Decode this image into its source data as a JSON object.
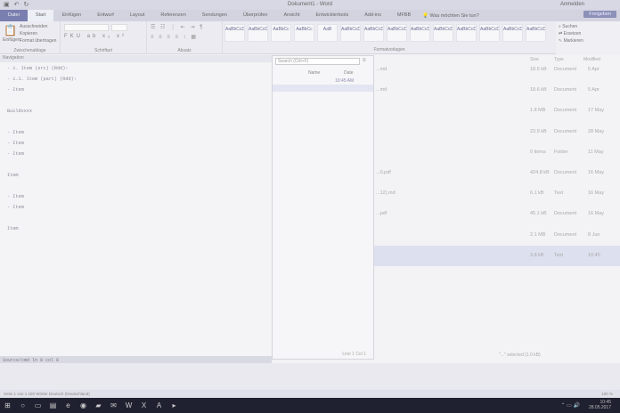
{
  "titlebar": {
    "title": "Dokument1 - Word",
    "user": "Anmelden"
  },
  "ribbon": {
    "tabs": [
      "Start",
      "Einfügen",
      "Entwurf",
      "Layout",
      "Referenzen",
      "Sendungen",
      "Überprüfen",
      "Ansicht",
      "Entwicklertools",
      "Add-ins",
      "MFBB"
    ],
    "file_tab": "Datei",
    "tell_me": "Was möchten Sie tun?",
    "share": "Freigeben",
    "clipboard": {
      "paste": "Einfügen",
      "cut": "Ausschneiden",
      "copy": "Kopieren",
      "format_painter": "Format übertragen",
      "label": "Zwischenablage"
    },
    "font_label": "Schriftart",
    "paragraph_label": "Absatz",
    "styles": [
      "AaBbCcDd",
      "AaBbCcDd",
      "AaBbCc",
      "AaBbCc",
      "AaB",
      "AaBbCcD",
      "AaBbCcD",
      "AaBbCcD",
      "AaBbCcD",
      "AaBbCcD",
      "AaBbCcD",
      "AaBbCcD",
      "AaBbCcDd",
      "AaBbCcD"
    ],
    "styles_label": "Formatvorlagen",
    "editing": {
      "find": "Suchen",
      "replace": "Ersetzen",
      "select": "Markieren",
      "label": "Bearbeiten"
    }
  },
  "pane_header": "Navigation",
  "editor": {
    "lines": [
      "- 1. Item (src) (Rdd):",
      "   - 1.1. Item (part) (Rdd):",
      "      - Item",
      "",
      "Buildxxxx",
      "",
      "- Item",
      "- Item",
      "- Item",
      "",
      "Item",
      "",
      "- Item",
      "- Item",
      "",
      "Item",
      "",
      "",
      "",
      "",
      "",
      "",
      ""
    ],
    "status": "Source/cmd  ln  0  col  0"
  },
  "explorer": {
    "search_placeholder": "Search (Ctrl+F)",
    "header_name": "Name",
    "header_date": "Date",
    "rows": [
      {
        "name": "",
        "date": "10:45 AM"
      },
      {
        "name": "",
        "date": ""
      }
    ],
    "footer": "Line 1  Col 1"
  },
  "filelist": {
    "headers": {
      "size": "Size",
      "type": "Type",
      "modified": "Modified"
    },
    "rows": [
      {
        "name": "...md",
        "size": "18.5 kB",
        "type": "Document",
        "date": "5 Apr"
      },
      {
        "name": "...md",
        "size": "18.6 kB",
        "type": "Document",
        "date": "5 Apr"
      },
      {
        "name": "",
        "size": "1.8 MB",
        "type": "Document",
        "date": "17 May"
      },
      {
        "name": "",
        "size": "23.9 kB",
        "type": "Document",
        "date": "28 May"
      },
      {
        "name": "",
        "size": "0 items",
        "type": "Folder",
        "date": "11 May"
      },
      {
        "name": "...0.pdf",
        "size": "424.8 kB",
        "type": "Document",
        "date": "16 May"
      },
      {
        "name": "...12).md",
        "size": "6.1 kB",
        "type": "Text",
        "date": "16 May"
      },
      {
        "name": "...pdf",
        "size": "45.1 kB",
        "type": "Document",
        "date": "16 May"
      },
      {
        "name": "",
        "size": "2.1 MB",
        "type": "Document",
        "date": "8 Jun"
      },
      {
        "name": "",
        "size": "3.8 kB",
        "type": "Text",
        "date": "10:45"
      },
      {
        "name": "",
        "size": "",
        "type": "",
        "date": ""
      }
    ],
    "selected_index": 9,
    "status": "\"...\" selected (1.0 kB)"
  },
  "word_status": {
    "left": "Seite 1 von 1   150 Wörter   Deutsch (Deutschland)",
    "zoom": "100 %"
  },
  "taskbar": {
    "icons": [
      "start-icon",
      "search-icon",
      "taskview-icon",
      "explorer-icon",
      "edge-icon",
      "chrome-icon",
      "folder-icon",
      "mail-icon",
      "word-icon",
      "excel-icon",
      "acrobat-icon",
      "terminal-icon"
    ],
    "time": "10:45",
    "date": "28.05.2017"
  }
}
